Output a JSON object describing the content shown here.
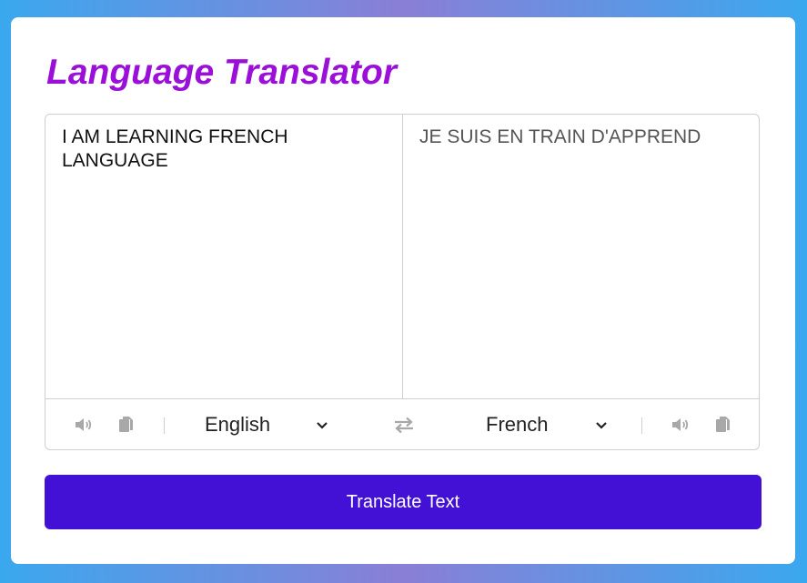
{
  "app": {
    "title": "Language Translator"
  },
  "from": {
    "text": "I AM LEARNING FRENCH LANGUAGE",
    "language": "English",
    "icons": [
      "speaker-icon",
      "copy-icon",
      "chevron-down-icon"
    ]
  },
  "to": {
    "text": "JE SUIS EN TRAIN D'APPREND",
    "language": "French",
    "icons": [
      "speaker-icon",
      "copy-icon",
      "chevron-down-icon"
    ]
  },
  "exchange_icon": "exchange-icon",
  "translate_button": {
    "label": "Translate Text"
  },
  "colors": {
    "title": "#9b10d8",
    "button": "#4310d6",
    "icon": "#a8a8a8",
    "border": "#cfcfcf"
  }
}
